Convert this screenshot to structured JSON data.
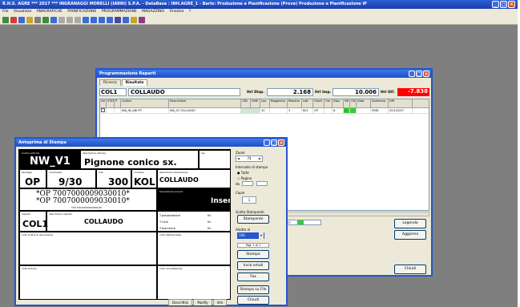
{
  "app": {
    "title": "R.H.S. AGRE *** 2017 *** INGRANAGGI MORELLI (IARRI) S.P.A. - DataBase : INH.AGRE_1 - Barlo: Produzione e Pianificazione (Prove) Produzione e Pianificazione iP",
    "menu": [
      "File",
      "Visualizza",
      "ANAGRAFICHE",
      "PIANIFICAZIONE",
      "PROGRAMMAZIONE",
      "MAGAZZINO",
      "Finestra",
      "?"
    ]
  },
  "report": {
    "title": "Programmazione Reparti",
    "tabs": [
      "Ricerca",
      "Risultato"
    ],
    "code": "COL1",
    "desc": "COLLAUDO",
    "disp_label": "Hrl Disp.",
    "disp_value": "2.168",
    "imp_label": "Hrl Imp.",
    "imp_value": "10.006",
    "diff_label": "Hrl Dif.",
    "diff_value": "-7.838",
    "grid_headers": [
      "Sel",
      "STAT",
      "P",
      "Codice",
      "Descrizione",
      "ODL",
      "FASE",
      "Lav.",
      "Raggiunto",
      "Residuo",
      "Lott",
      "Giorni",
      "Ore",
      "Disp.",
      "NR",
      "OD",
      "Data",
      "Scadenza",
      "Diff"
    ],
    "grid_row": [
      "",
      "",
      "",
      "INA_IN_ANI PP",
      "INA_VI COLLAUDO",
      "",
      "",
      "10",
      "",
      "3",
      "601",
      "OP",
      "",
      "6",
      "1",
      "",
      "",
      "9981",
      "20/1/2007"
    ],
    "bottom_code": "9057",
    "buttons": {
      "legend": "Legenda",
      "refresh": "Aggiorna",
      "close": "Chiudi"
    }
  },
  "preview": {
    "title": "Anteprima di Stampa",
    "label": {
      "cap_code": "Codice articolo",
      "code": "NW_V1",
      "cap_desc": "descrizione articolo",
      "desc": "Pignone conico sx.",
      "cap_rev": "rev.",
      "cap_type": "tipologia",
      "type": "OP",
      "cap_order": "commessa",
      "order": "9/30",
      "cap_qty": "q.ta",
      "qty": "300",
      "cap_phase": "cod.fase",
      "phase": "KOL",
      "cap_phase_desc": "descrizione lavorazione",
      "phase_desc": "COLLAUDO",
      "barcode_1": "*OP 7007000009030010*",
      "barcode_2": "*OP 7007000009030010*",
      "barcode_sub": "*OP 7007000009030010*",
      "cap_prev": "lavorazione preced.",
      "prev": "Inserit",
      "cap_dept": "reparto",
      "dept": "COL1",
      "cap_dept_desc": "descrizione reparto",
      "dept_desc": "COLLAUDO",
      "times": [
        "T.preparazione",
        "T.ciclo",
        "T.macchina"
      ],
      "times_unit": [
        "hh",
        "hh",
        "hh"
      ],
      "cap_notes": "note ordine di lavorazione",
      "cap_dist": "note distinta base",
      "cap_art": "note articolo",
      "cap_cons": "note consultazione"
    },
    "side": {
      "zoom_label": "Zoom",
      "zoom_value": "74",
      "range_label": "Intervallo di stampa",
      "all_label": "Tutte",
      "pages_label": "Pagine",
      "from_label": "da",
      "copies_label": "Copie",
      "copies_value": "1",
      "printer_label": "Scelta Stampante",
      "printer_btn": "Stampante",
      "fit_label": "Adatta al",
      "fit_value": "100",
      "page_info": "Pag. 1 di 1",
      "print_btn": "Stampa",
      "email_btn": "Invio email",
      "fax_btn": "Fax",
      "file_btn": "Stampa su File",
      "close_btn": "Chiudi"
    },
    "bottom_tabs": [
      "Descrittivi",
      "Modify",
      "Info"
    ]
  }
}
